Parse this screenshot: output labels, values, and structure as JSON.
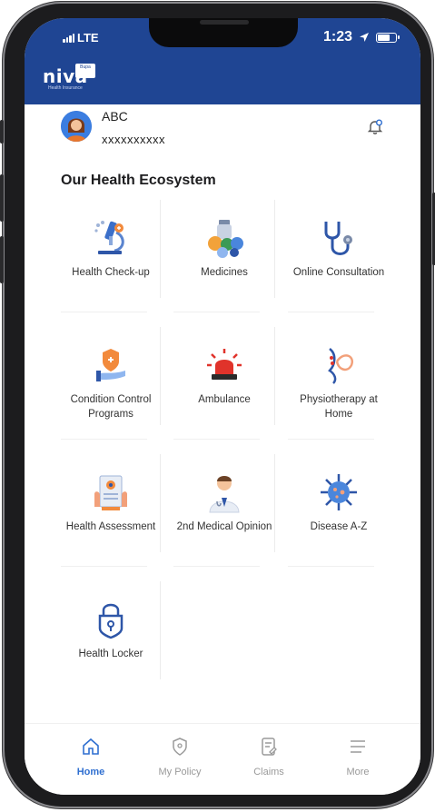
{
  "status": {
    "network": "LTE",
    "time": "1:23"
  },
  "brand": {
    "name": "niva",
    "tagline": "Health Insurance",
    "badge": "Bupa"
  },
  "user": {
    "name": "ABC",
    "id": "xxxxxxxxxx"
  },
  "section_title": "Our Health Ecosystem",
  "tiles": [
    {
      "label": "Health Check-up",
      "icon": "microscope-icon"
    },
    {
      "label": "Medicines",
      "icon": "pills-icon"
    },
    {
      "label": "Online Consultation",
      "icon": "stethoscope-icon"
    },
    {
      "label": "Condition Control Programs",
      "icon": "shield-hand-icon"
    },
    {
      "label": "Ambulance",
      "icon": "siren-icon"
    },
    {
      "label": "Physiotherapy at Home",
      "icon": "physio-icon"
    },
    {
      "label": "Health Assessment",
      "icon": "clipboard-icon"
    },
    {
      "label": "2nd Medical Opinion",
      "icon": "doctor-icon"
    },
    {
      "label": "Disease A-Z",
      "icon": "virus-icon"
    },
    {
      "label": "Health Locker",
      "icon": "lock-icon"
    }
  ],
  "nav": [
    {
      "label": "Home",
      "icon": "home-icon",
      "active": true
    },
    {
      "label": "My Policy",
      "icon": "policy-shield-icon",
      "active": false
    },
    {
      "label": "Claims",
      "icon": "claims-document-icon",
      "active": false
    },
    {
      "label": "More",
      "icon": "menu-icon",
      "active": false
    }
  ],
  "colors": {
    "header": "#1f4593",
    "accent": "#2f6fd0"
  }
}
